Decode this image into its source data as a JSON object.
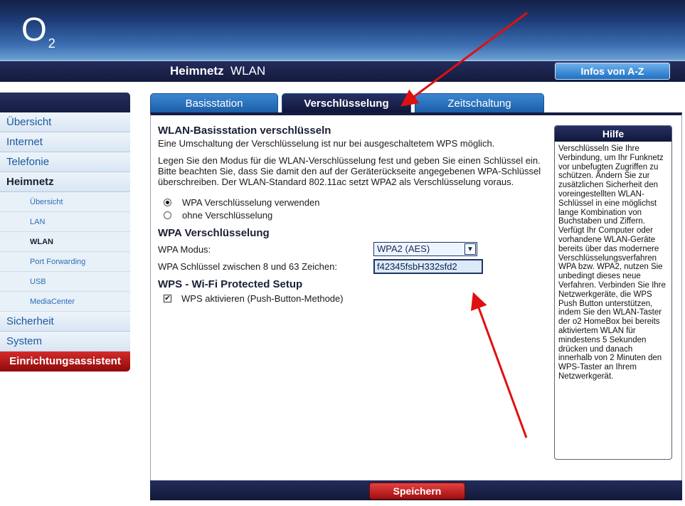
{
  "brand": {
    "logo": "O",
    "logo_sub": "2"
  },
  "header": {
    "section": "Heimnetz",
    "page": "WLAN",
    "infos_button": "Infos von A-Z"
  },
  "tabs": [
    {
      "label": "Basisstation",
      "active": false
    },
    {
      "label": "Verschlüsselung",
      "active": true
    },
    {
      "label": "Zeitschaltung",
      "active": false
    }
  ],
  "sidebar": {
    "items": [
      {
        "label": "Übersicht"
      },
      {
        "label": "Internet"
      },
      {
        "label": "Telefonie"
      },
      {
        "label": "Heimnetz",
        "active": true
      }
    ],
    "subitems": [
      {
        "label": "Übersicht"
      },
      {
        "label": "LAN"
      },
      {
        "label": "WLAN",
        "active": true
      },
      {
        "label": "Port Forwarding"
      },
      {
        "label": "USB"
      },
      {
        "label": "MediaCenter"
      }
    ],
    "items_after": [
      {
        "label": "Sicherheit"
      },
      {
        "label": "System"
      }
    ],
    "wizard": "Einrichtungsassistent"
  },
  "main": {
    "section1_title": "WLAN-Basisstation verschlüsseln",
    "section1_p1": "Eine Umschaltung der Verschlüsselung ist nur bei ausgeschaltetem WPS möglich.",
    "section1_p2": "Legen Sie den Modus für die WLAN-Verschlüsselung fest und geben Sie einen Schlüssel ein. Bitte beachten Sie, dass Sie damit den auf der Geräterückseite angegebenen WPA-Schlüssel überschreiben. Der WLAN-Standard 802.11ac setzt WPA2 als Verschlüsselung voraus.",
    "radio_wpa": "WPA Verschlüsselung verwenden",
    "radio_none": "ohne Verschlüsselung",
    "radio_selected": "wpa",
    "section2_title": "WPA Verschlüsselung",
    "wpa_mode_label": "WPA Modus:",
    "wpa_mode_value": "WPA2 (AES)",
    "wpa_key_label": "WPA Schlüssel zwischen 8 und 63 Zeichen:",
    "wpa_key_value": "f42345fsbH332sfd2",
    "section3_title": "WPS - Wi-Fi Protected Setup",
    "wps_checkbox_label": "WPS aktivieren (Push-Button-Methode)",
    "wps_checked": true
  },
  "help": {
    "title": "Hilfe",
    "text": "Verschlüsseln Sie Ihre Verbindung, um Ihr Funknetz vor unbefugten Zugriffen zu schützen. Ändern Sie zur zusätzlichen Sicherheit den voreingestellten WLAN-Schlüssel in eine möglichst lange Kombination von Buchstaben und Ziffern. Verfügt Ihr Computer oder vorhandene WLAN-Geräte bereits über das modernere Verschlüsselungsverfahren WPA bzw. WPA2, nutzen Sie unbedingt dieses neue Verfahren. Verbinden Sie Ihre Netzwerkgeräte, die WPS Push Button unterstützen, indem Sie den WLAN-Taster der o2 HomeBox bei bereits aktiviertem WLAN für mindestens 5 Sekunden drücken und danach innerhalb von 2 Minuten den WPS-Taster an Ihrem Netzwerkgerät."
  },
  "footer": {
    "save_button": "Speichern"
  },
  "colors": {
    "annotation_arrow": "#e01010",
    "accent_dark": "#161c40",
    "tab_blue": "#2a72c0",
    "save_red": "#c41e1e"
  }
}
